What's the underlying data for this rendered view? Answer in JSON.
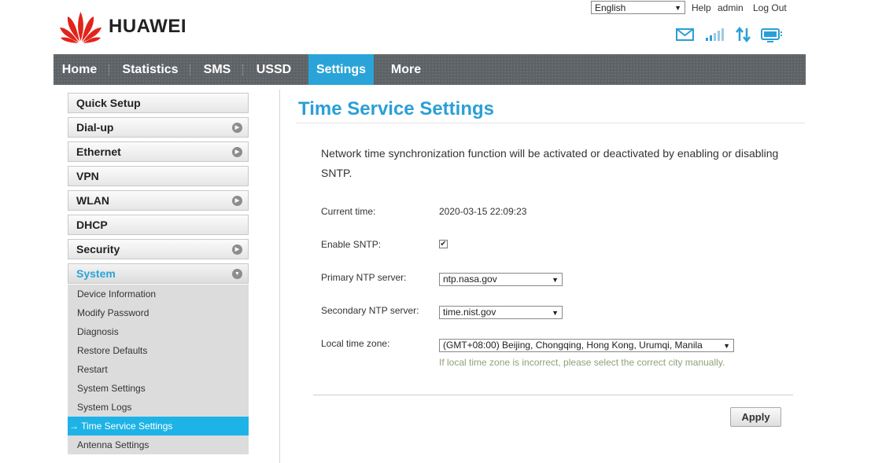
{
  "header": {
    "brand": "HUAWEI",
    "language": "English",
    "links": {
      "help": "Help",
      "user": "admin",
      "logout": "Log Out"
    },
    "icons": [
      "mail-icon",
      "signal-icon",
      "data-transfer-icon",
      "monitor-icon"
    ],
    "accent_color": "#2aa4d8",
    "logo_color": "#e2231a"
  },
  "nav": {
    "items": [
      "Home",
      "Statistics",
      "SMS",
      "USSD",
      "Settings",
      "More"
    ],
    "active": "Settings"
  },
  "sidebar": {
    "sections": [
      "Quick Setup",
      "Dial-up",
      "Ethernet",
      "VPN",
      "WLAN",
      "DHCP",
      "Security",
      "System"
    ],
    "open_section": "System",
    "system_items": [
      "Device Information",
      "Modify Password",
      "Diagnosis",
      "Restore Defaults",
      "Restart",
      "System Settings",
      "System Logs",
      "Time Service Settings",
      "Antenna Settings"
    ],
    "active_item_arrow": "→",
    "active_item": "Time Service Settings"
  },
  "main": {
    "title": "Time Service Settings",
    "description": "Network time synchronization function will be activated or deactivated by enabling or disabling SNTP.",
    "current_time_label": "Current time:",
    "current_time_value": "2020-03-15 22:09:23",
    "enable_sntp_label": "Enable SNTP:",
    "enable_sntp_checked": "✔",
    "primary_label": "Primary NTP server:",
    "primary_value": "ntp.nasa.gov",
    "secondary_label": "Secondary NTP server:",
    "secondary_value": "time.nist.gov",
    "timezone_label": "Local time zone:",
    "timezone_value": "(GMT+08:00) Beijing, Chongqing, Hong Kong, Urumqi, Manila",
    "timezone_hint": "If local time zone is incorrect, please select the correct city manually.",
    "apply_label": "Apply",
    "dropdown_caret": "▼"
  }
}
